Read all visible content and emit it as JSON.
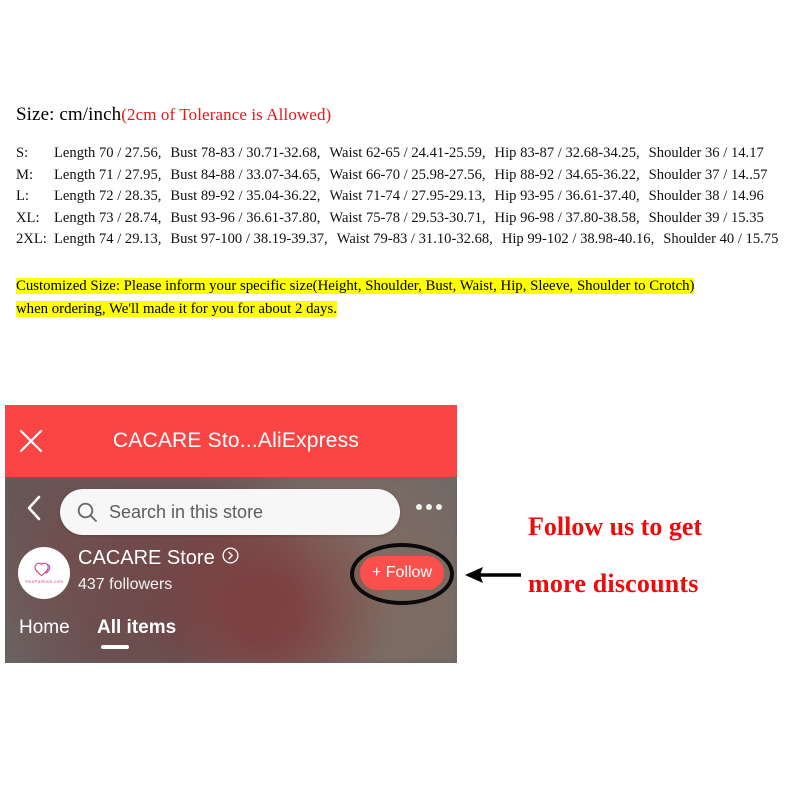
{
  "size_chart": {
    "title_main": "Size: cm/inch",
    "title_note": "(2cm of Tolerance is Allowed)",
    "rows": [
      {
        "label": "S:",
        "length": "Length 70 / 27.56,",
        "bust": "Bust 78-83 / 30.71-32.68,",
        "waist": "Waist 62-65 / 24.41-25.59,",
        "hip": "Hip 83-87 / 32.68-34.25,",
        "shoulder": "Shoulder 36 / 14.17"
      },
      {
        "label": "M:",
        "length": "Length 71 / 27.95,",
        "bust": "Bust 84-88 / 33.07-34.65,",
        "waist": "Waist 66-70 / 25.98-27.56,",
        "hip": "Hip 88-92 / 34.65-36.22,",
        "shoulder": "Shoulder 37 / 14..57"
      },
      {
        "label": "L:",
        "length": "Length 72 / 28.35,",
        "bust": "Bust 89-92 / 35.04-36.22,",
        "waist": "Waist 71-74 / 27.95-29.13,",
        "hip": "Hip 93-95 / 36.61-37.40,",
        "shoulder": "Shoulder 38 / 14.96"
      },
      {
        "label": "XL:",
        "length": "Length 73 / 28.74,",
        "bust": "Bust 93-96 / 36.61-37.80,",
        "waist": "Waist 75-78 / 29.53-30.71,",
        "hip": "Hip 96-98 / 37.80-38.58,",
        "shoulder": "Shoulder 39 / 15.35"
      },
      {
        "label": "2XL:",
        "length": "Length 74 / 29.13,",
        "bust": "Bust 97-100 / 38.19-39.37,",
        "waist": "Waist 79-83 / 31.10-32.68,",
        "hip": "Hip 99-102 / 38.98-40.16,",
        "shoulder": "Shoulder 40 / 15.75"
      }
    ]
  },
  "custom_note": {
    "line1": "Customized Size: Please inform your specific size(Height, Shoulder, Bust, Waist, Hip, Sleeve, Shoulder to Crotch)",
    "line2": "when ordering, We'll made it for you for about 2 days.",
    "highlight_color": "#ffff00"
  },
  "app_screenshot": {
    "header": {
      "title": "CACARE Sto...AliExpress",
      "close_icon": "close-icon",
      "background_color": "#fb4545"
    },
    "search": {
      "placeholder": "Search in this store",
      "icon": "search-icon"
    },
    "back_icon": "chevron-left-icon",
    "overflow_icon": "more-horizontal-icon",
    "store": {
      "name": "CACARE Store",
      "name_chevron_icon": "chevron-right-circle-icon",
      "followers": "437  followers",
      "avatar_sub": "YourFashion.com",
      "follow_label": "+ Follow",
      "follow_color": "#f9504c"
    },
    "tabs": [
      {
        "label": "Home",
        "active": false
      },
      {
        "label": "All items",
        "active": true
      }
    ]
  },
  "annotation": {
    "line1": "Follow us to get",
    "line2": "more discounts",
    "color": "#ee0b0b",
    "arrow_icon": "arrow-left-icon"
  }
}
